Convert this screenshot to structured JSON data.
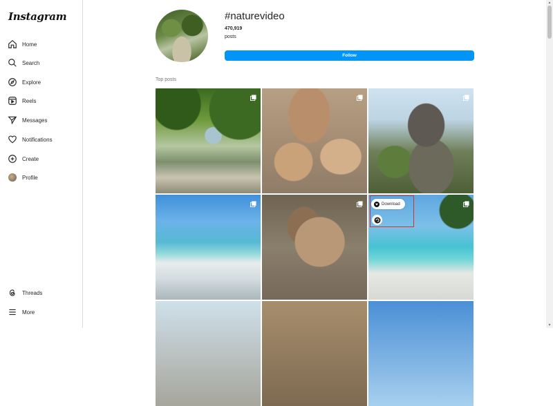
{
  "app": {
    "logo": "Instagram"
  },
  "sidebar": {
    "items": [
      {
        "label": "Home",
        "icon": "home-icon"
      },
      {
        "label": "Search",
        "icon": "search-icon"
      },
      {
        "label": "Explore",
        "icon": "compass-icon"
      },
      {
        "label": "Reels",
        "icon": "reels-icon"
      },
      {
        "label": "Messages",
        "icon": "send-icon"
      },
      {
        "label": "Notifications",
        "icon": "heart-icon"
      },
      {
        "label": "Create",
        "icon": "plus-square-icon"
      },
      {
        "label": "Profile",
        "icon": "avatar-icon"
      }
    ],
    "bottom": [
      {
        "label": "Threads",
        "icon": "threads-icon"
      },
      {
        "label": "More",
        "icon": "menu-icon"
      }
    ]
  },
  "header": {
    "hashtag": "#naturevideo",
    "count": "470,919",
    "count_label": "posts",
    "follow_label": "Follow"
  },
  "section_title": "Top posts",
  "overlay": {
    "download_label": "Download"
  },
  "colors": {
    "primary": "#0095f6",
    "highlight": "#d2352c"
  }
}
